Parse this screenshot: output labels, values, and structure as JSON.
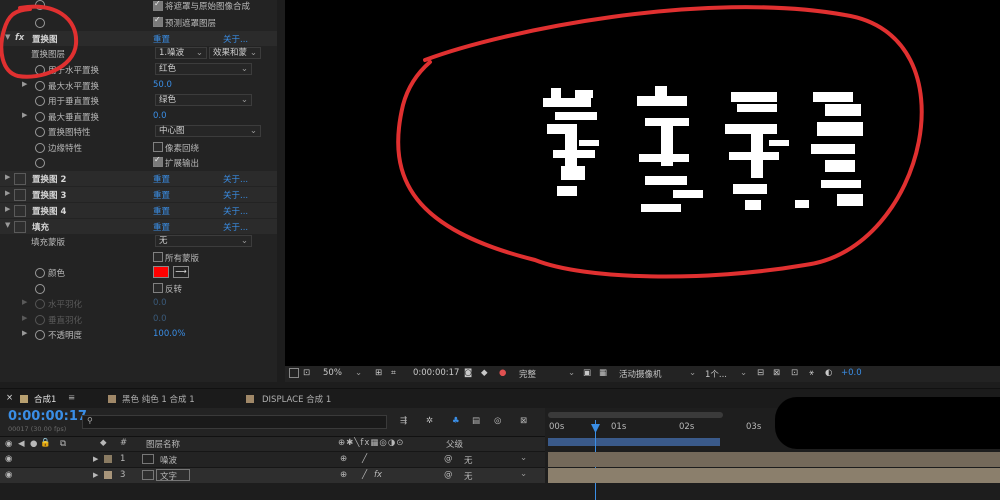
{
  "effects": {
    "top_rows": [
      {
        "label": "将遮罩与原始图像合成"
      },
      {
        "label": "预测遮罩图层"
      }
    ],
    "displace_map": {
      "name": "置换图",
      "reset": "重置",
      "about": "关于...",
      "map_layer_label": "置换图层",
      "map_layer_value": "1.噪波",
      "map_layer_source": "效果和蒙",
      "h_use_label": "用于水平置换",
      "h_use_value": "红色",
      "max_h_label": "最大水平置换",
      "max_h_value": "50.0",
      "v_use_label": "用于垂直置换",
      "v_use_value": "绿色",
      "max_v_label": "最大垂直置换",
      "max_v_value": "0.0",
      "behavior_label": "置换图特性",
      "behavior_value": "中心图",
      "edge_label": "边缘特性",
      "wrap_label": "像素回绕",
      "expand_label": "扩展输出"
    },
    "displace_2": {
      "name": "置换图 2",
      "reset": "重置",
      "about": "关于..."
    },
    "displace_3": {
      "name": "置换图 3",
      "reset": "重置",
      "about": "关于..."
    },
    "displace_4": {
      "name": "置换图 4",
      "reset": "重置",
      "about": "关于..."
    },
    "fill": {
      "name": "填充",
      "reset": "重置",
      "about": "关于...",
      "mask_label": "填充蒙版",
      "mask_value": "无",
      "all_masks_label": "所有蒙版",
      "color_label": "颜色",
      "color_value": "#ff0000",
      "invert_label": "反转",
      "h_feather_label": "水平羽化",
      "h_feather_value": "0.0",
      "v_feather_label": "垂直羽化",
      "v_feather_value": "0.0",
      "opacity_label": "不透明度",
      "opacity_value": "100.0%"
    }
  },
  "viewer": {
    "zoom": "50%",
    "timecode": "0:00:00:17",
    "resolution": "完整",
    "camera": "活动摄像机",
    "views": "1个...",
    "exposure": "+0.0"
  },
  "timeline": {
    "tabs": [
      {
        "label": "合成1",
        "color": "#b8a070"
      },
      {
        "label": "黑色 纯色 1 合成 1",
        "color": "#a08868"
      },
      {
        "label": "DISPLACE 合成 1",
        "color": "#a08868"
      }
    ],
    "current_time": "0:00:00:17",
    "frame_info": "00017 (30.00 fps)",
    "search_placeholder": "",
    "col_number": "#",
    "col_layer_name": "图层名称",
    "col_parent": "父级",
    "ruler_ticks": [
      "00s",
      "01s",
      "02s",
      "03s"
    ],
    "layers": [
      {
        "index": "1",
        "name": "噪波",
        "parent": "无"
      },
      {
        "index": "3",
        "name": "文字",
        "parent": "无"
      }
    ]
  }
}
